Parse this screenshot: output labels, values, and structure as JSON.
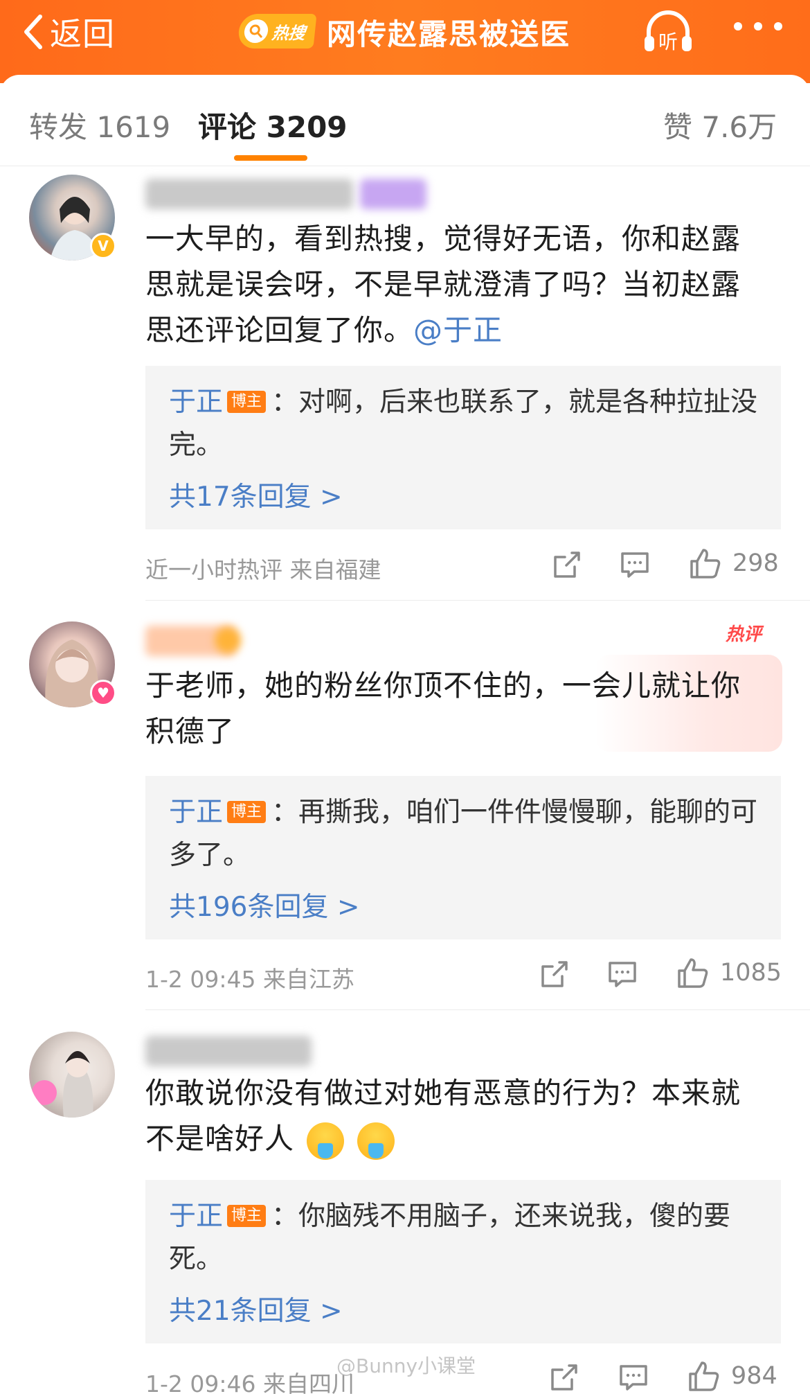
{
  "header": {
    "back_label": "返回",
    "hot_badge": "热搜",
    "title": "网传赵露思被送医",
    "listen_label": "听"
  },
  "tabs": [
    {
      "label": "转发 1619"
    },
    {
      "label": "评论 3209"
    },
    {
      "label": "赞 7.6万"
    }
  ],
  "comments": [
    {
      "text": "一大早的，看到热搜，觉得好无语，你和赵露思就是误会呀，不是早就澄清了吗？当初赵露思还评论回复了你。",
      "mention": "@于正",
      "reply": {
        "author": "于正",
        "tag": "博主",
        "text": "：对啊，后来也联系了，就是各种拉扯没完。"
      },
      "reply_count": "共17条回复 >",
      "meta": "近一小时热评  来自福建",
      "likes": "298"
    },
    {
      "hot_label": "热评",
      "text": "于老师，她的粉丝你顶不住的，一会儿就让你积德了",
      "reply": {
        "author": "于正",
        "tag": "博主",
        "text": "：再撕我，咱们一件件慢慢聊，能聊的可多了。"
      },
      "reply_count": "共196条回复 >",
      "meta": "1-2 09:45  来自江苏",
      "likes": "1085"
    },
    {
      "text": "你敢说你没有做过对她有恶意的行为？本来就不是啥好人",
      "reply": {
        "author": "于正",
        "tag": "博主",
        "text": "：你脑残不用脑子，还来说我，傻的要死。"
      },
      "reply_count": "共21条回复 >",
      "meta": "1-2 09:46  来自四川",
      "likes": "984"
    }
  ],
  "watermark": "@Bunny小课堂",
  "colors": {
    "header": "#ff7a1e",
    "accent": "#ff8200",
    "link": "#4a7ec6",
    "host_tag": "#ff7d14"
  }
}
